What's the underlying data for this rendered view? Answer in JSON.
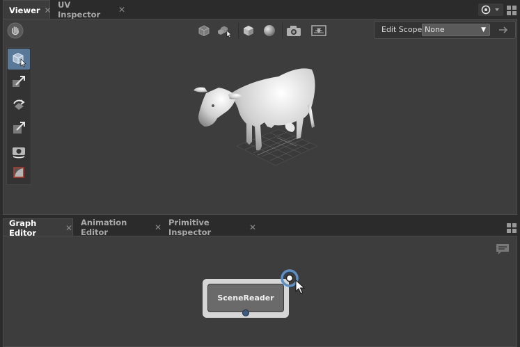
{
  "top_tabs": [
    {
      "label": "Viewer",
      "active": true
    },
    {
      "label": "UV Inspector",
      "active": false
    }
  ],
  "viewer": {
    "edit_scope_label": "Edit Scope",
    "edit_scope_value": "None",
    "toolbar_icons": [
      "cube-wire-icon",
      "cube-select-icon",
      "cube-solid-icon",
      "sphere-icon",
      "camera-icon",
      "grid-camera-icon"
    ],
    "tools": [
      "select-tool-icon",
      "translate-tool-icon",
      "rotate-tool-icon",
      "scale-tool-icon",
      "camera-tool-icon",
      "crop-tool-icon"
    ]
  },
  "bottom_tabs": [
    {
      "label": "Graph Editor",
      "active": true
    },
    {
      "label": "Animation Editor",
      "active": false
    },
    {
      "label": "Primitive Inspector",
      "active": false
    }
  ],
  "graph": {
    "node_label": "SceneReader"
  },
  "colors": {
    "accent": "#5b8fc7",
    "panel": "#3d3d3d",
    "background": "#2b2b2b"
  }
}
